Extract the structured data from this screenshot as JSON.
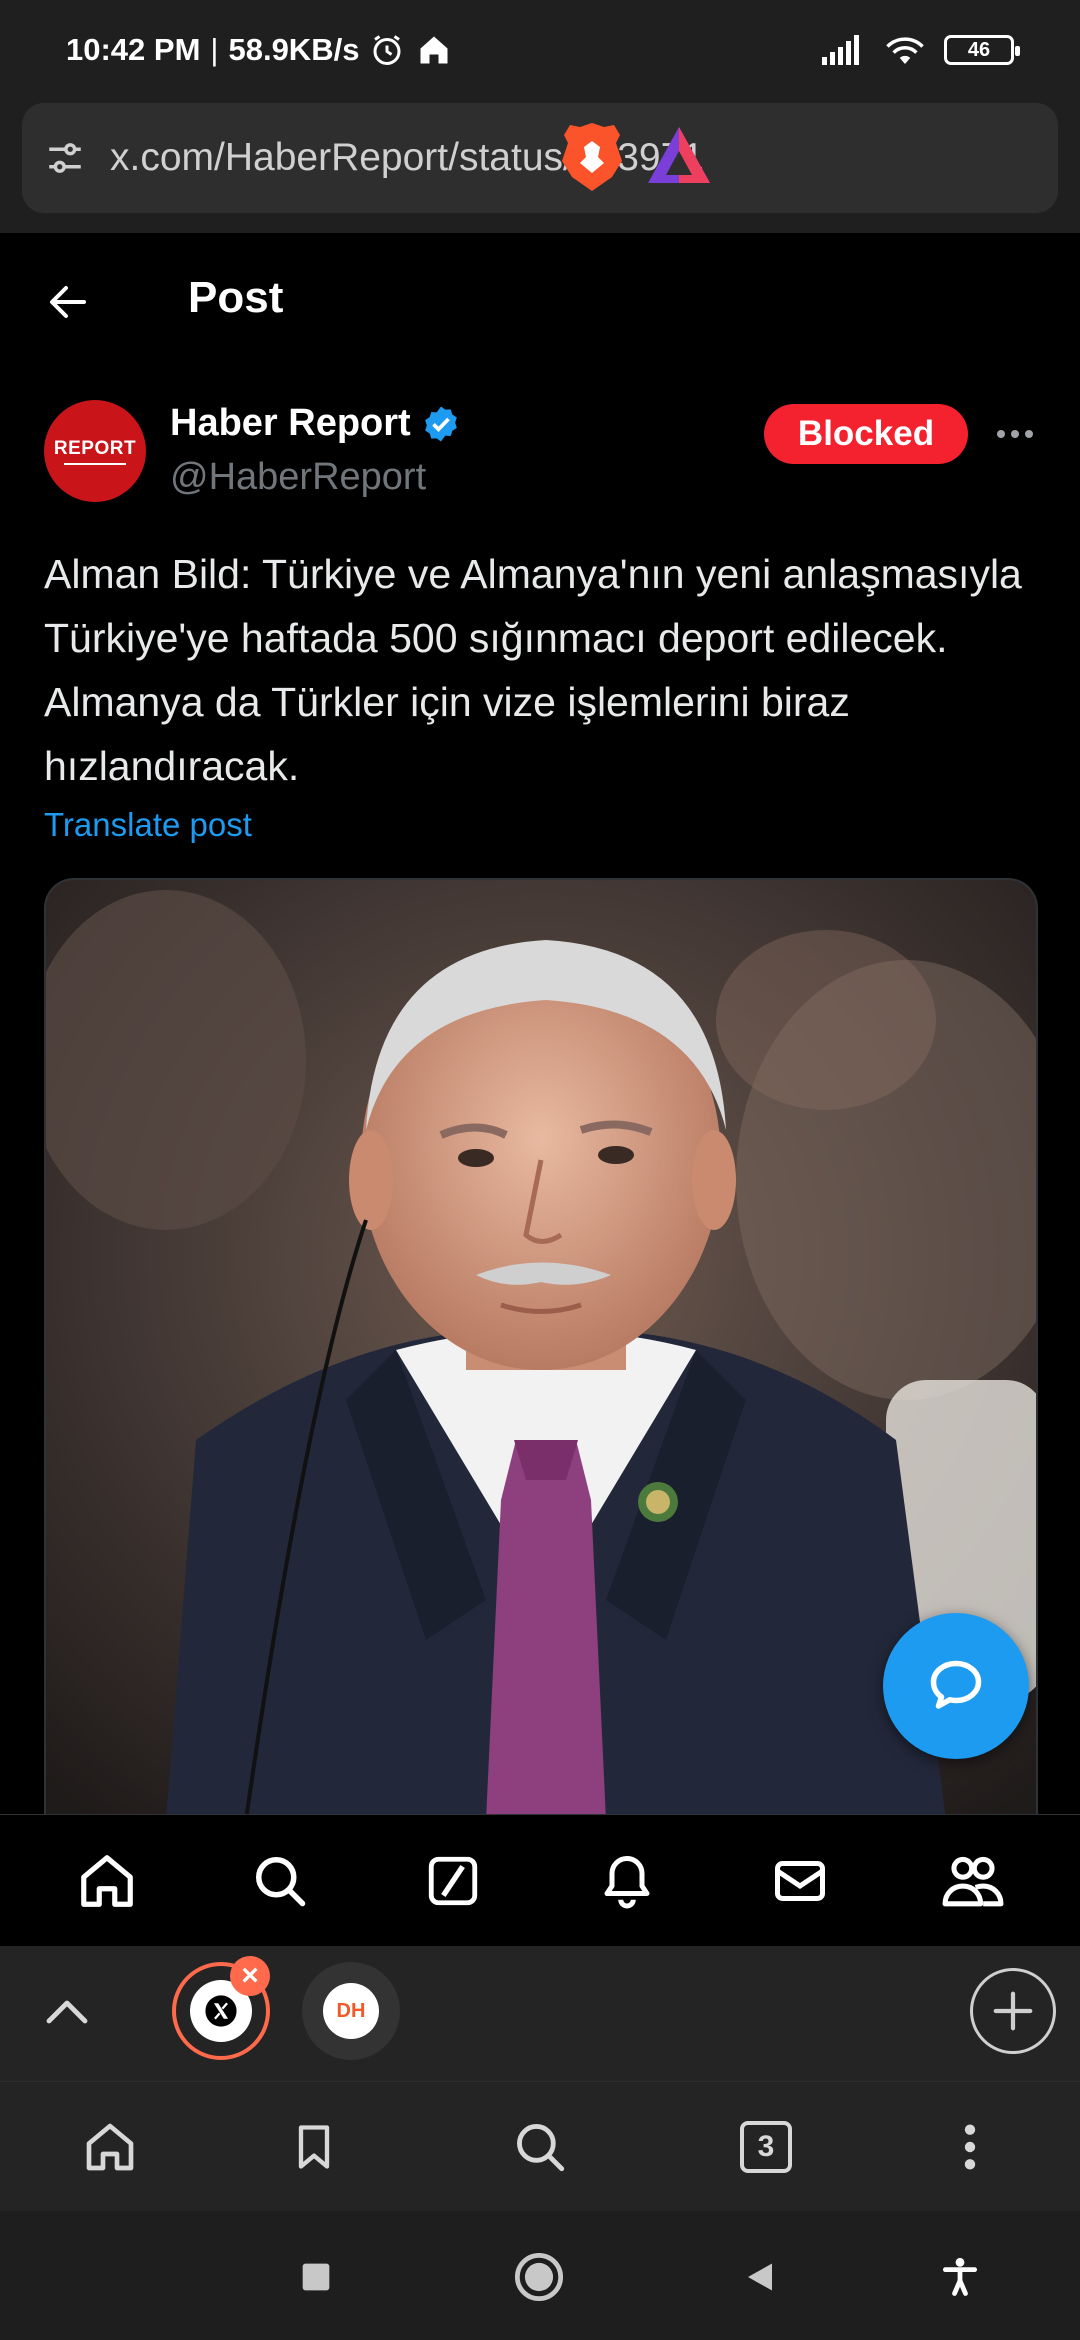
{
  "status_bar": {
    "time": "10:42 PM",
    "speed": "58.9KB/s",
    "battery": "46"
  },
  "browser": {
    "url": "x.com/HaberReport/status/183971"
  },
  "header": {
    "title": "Post"
  },
  "post": {
    "author_name": "Haber Report",
    "author_handle": "@HaberReport",
    "avatar_text": "REPORT",
    "blocked_label": "Blocked",
    "text": "Alman Bild: Türkiye ve Almanya'nın yeni anlaşmasıyla Türkiye'ye haftada 500 sığınmacı deport edilecek. Almanya da Türkler için vize işlemlerini biraz hızlandıracak.",
    "translate_label": "Translate post"
  },
  "tabs": {
    "x_close_glyph": "×",
    "dh_label": "DH",
    "count": "3"
  },
  "colors": {
    "accent": "#1d9bf0",
    "blocked": "#f4212e",
    "tab_ring": "#ff6a4d"
  }
}
